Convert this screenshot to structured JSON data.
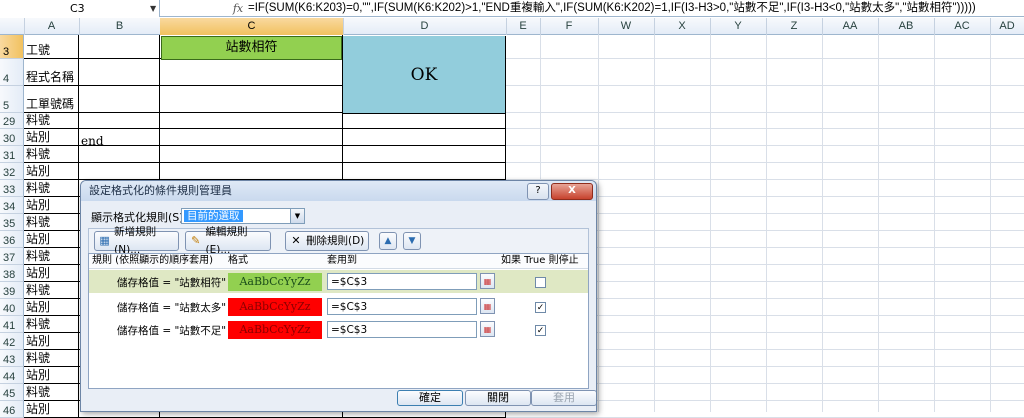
{
  "formula_bar": {
    "cell_ref": "C3",
    "fx_label": "fx",
    "formula": "=IF(SUM(K6:K203)=0,\"\",IF(SUM(K6:K202)>1,\"END重複輸入\",IF(SUM(K6:K202)=1,IF(I3-H3>0,\"站數不足\",IF(I3-H3<0,\"站數太多\",\"站數相符\")))))"
  },
  "columns": [
    "A",
    "B",
    "C",
    "D",
    "E",
    "F",
    "W",
    "X",
    "Y",
    "Z",
    "AA",
    "AB",
    "AC",
    "AD"
  ],
  "sheet": {
    "c3_value": "站數相符",
    "d3_value": "OK",
    "b30_value": "end",
    "rows": [
      {
        "num": "3",
        "a": "工號"
      },
      {
        "num": "4",
        "a": "程式名稱"
      },
      {
        "num": "5",
        "a": "工單號碼"
      },
      {
        "num": "29",
        "a": "料號"
      },
      {
        "num": "30",
        "a": "站別"
      },
      {
        "num": "31",
        "a": "料號"
      },
      {
        "num": "32",
        "a": "站別"
      },
      {
        "num": "33",
        "a": "料號"
      },
      {
        "num": "34",
        "a": "站別"
      },
      {
        "num": "35",
        "a": "料號"
      },
      {
        "num": "36",
        "a": "站別"
      },
      {
        "num": "37",
        "a": "料號"
      },
      {
        "num": "38",
        "a": "站別"
      },
      {
        "num": "39",
        "a": "料號"
      },
      {
        "num": "40",
        "a": "站別"
      },
      {
        "num": "41",
        "a": "料號"
      },
      {
        "num": "42",
        "a": "站別"
      },
      {
        "num": "43",
        "a": "料號"
      },
      {
        "num": "44",
        "a": "站別"
      },
      {
        "num": "45",
        "a": "料號"
      },
      {
        "num": "46",
        "a": "站別"
      }
    ]
  },
  "dialog": {
    "title": "設定格式化的條件規則管理員",
    "help_btn": "?",
    "close_btn": "X",
    "show_label": "顯示格式化規則(S):",
    "show_value": "目前的選取",
    "toolbar": {
      "new_rule": "新增規則(N)...",
      "edit_rule": "編輯規則(E)...",
      "delete_rule": "刪除規則(D)"
    },
    "table_headers": {
      "rule": "規則 (依照顯示的順序套用)",
      "format": "格式",
      "applies_to": "套用到",
      "stop_if_true": "如果 True 則停止"
    },
    "rules": [
      {
        "name": "儲存格值 = \"站數相符\"",
        "preview": "AaBbCcYyZz",
        "applies": "=$C$3",
        "stop": "",
        "bg": "#92d050",
        "fg": "#1a4d1a"
      },
      {
        "name": "儲存格值 = \"站數太多\"",
        "preview": "AaBbCcYyZz",
        "applies": "=$C$3",
        "stop": "✓",
        "bg": "#ff0000",
        "fg": "#8b0000"
      },
      {
        "name": "儲存格值 = \"站數不足\"",
        "preview": "AaBbCcYyZz",
        "applies": "=$C$3",
        "stop": "✓",
        "bg": "#ff0000",
        "fg": "#8b0000"
      }
    ],
    "ok_btn": "確定",
    "close_footer_btn": "關閉",
    "apply_btn": "套用"
  },
  "colors": {
    "c3_fill": "#92d050",
    "d3_fill": "#92cddc",
    "selected_header": "#f1c15f"
  }
}
